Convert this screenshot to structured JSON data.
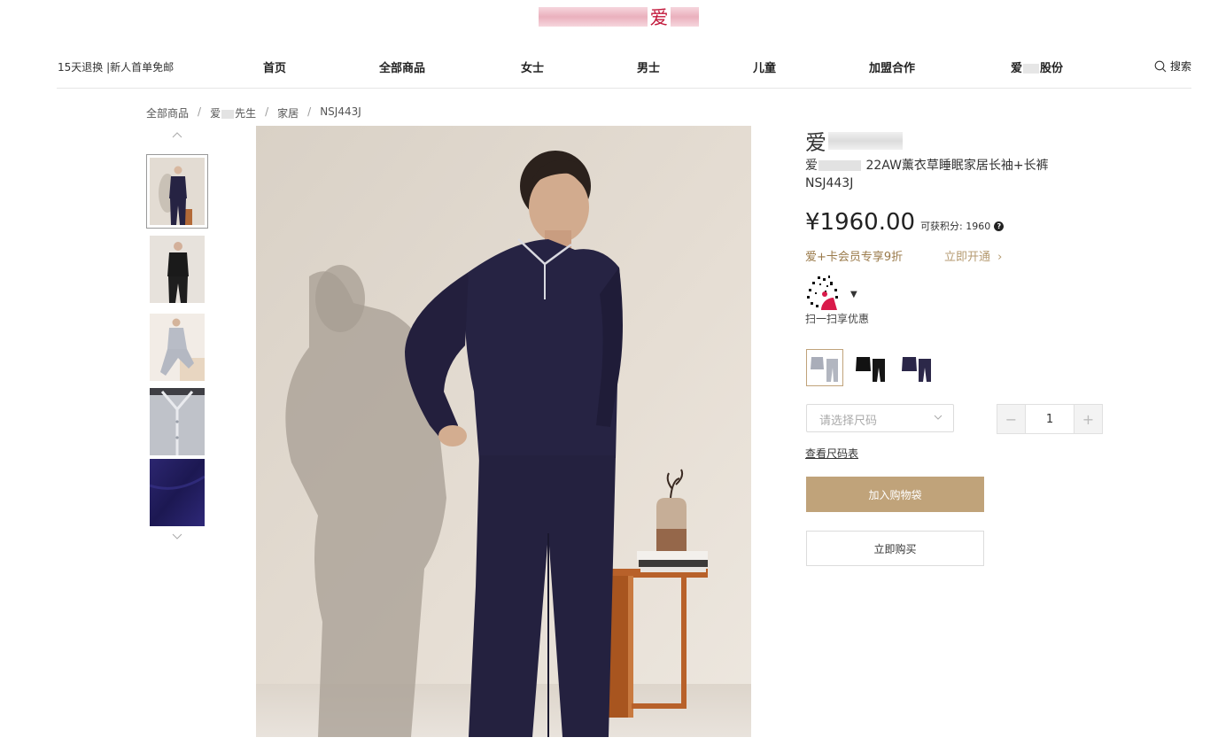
{
  "logo": {
    "char": "爱"
  },
  "nav": {
    "promo": "15天退换 |新人首单免邮",
    "items": [
      {
        "label": "首页"
      },
      {
        "label": "全部商品"
      },
      {
        "label": "女士"
      },
      {
        "label": "男士"
      },
      {
        "label": "儿童"
      },
      {
        "label": "加盟合作"
      },
      {
        "label_prefix": "爱",
        "label_suffix": "股份"
      }
    ],
    "search_label": "搜索"
  },
  "breadcrumb": {
    "items": [
      "全部商品",
      "爱",
      "先生",
      "家居",
      "NSJ443J"
    ],
    "separator": "/"
  },
  "thumbnails": {
    "count": 5,
    "selected_index": 0
  },
  "product": {
    "brand_char": "爱",
    "title_prefix": "爱",
    "title_rest": "22AW薰衣草睡眠家居长袖+长裤NSJ443J",
    "price": "¥1960.00",
    "points_label": "可获积分: 1960",
    "member_offer": "爱+卡会员专享9折",
    "member_link": "立即开通",
    "qr_caption": "扫一扫享优惠",
    "colors": [
      "grey",
      "black",
      "navy"
    ],
    "selected_color_index": 0,
    "size_placeholder": "请选择尺码",
    "quantity": "1",
    "size_chart_link": "查看尺码表",
    "add_to_bag": "加入购物袋",
    "buy_now": "立即购买"
  },
  "colors": {
    "accent": "#c0a37a",
    "brand": "#c2183b",
    "navy": "#262343"
  }
}
